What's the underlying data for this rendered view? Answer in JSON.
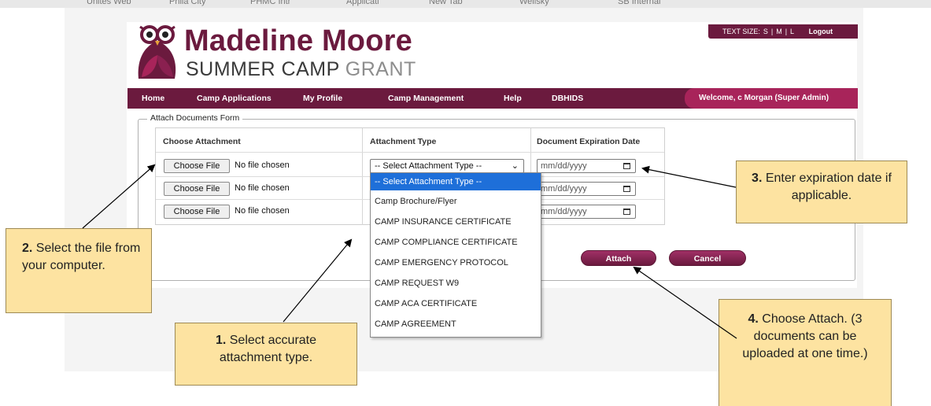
{
  "browser_strip": [
    "Unites Web",
    "Phila City",
    "PHMC Intr",
    "Applicati",
    "New Tab",
    "Wellsky",
    "SB Internal"
  ],
  "header": {
    "brand_line1": "Madeline Moore",
    "brand_line2a": "SUMMER CAMP",
    "brand_line2b": "GRANT",
    "text_size_label": "TEXT SIZE:",
    "size_s": "S",
    "size_m": "M",
    "size_l": "L",
    "separator": "|",
    "logout": "Logout"
  },
  "nav": {
    "items": [
      "Home",
      "Camp Applications",
      "My Profile",
      "Camp Management",
      "Help",
      "DBHIDS"
    ],
    "welcome": "Welcome, c Morgan  (Super Admin)"
  },
  "form": {
    "legend": "Attach Documents Form",
    "col_attachment": "Choose Attachment",
    "col_type": "Attachment Type",
    "col_date": "Document Expiration Date",
    "choose_file": "Choose File",
    "no_file": "No file chosen",
    "select_value": "-- Select Attachment Type --",
    "select_chevron": "⌄",
    "date_placeholder": "mm/dd/yyyy",
    "attach_button": "Attach",
    "cancel_button": "Cancel"
  },
  "dropdown_options": [
    "-- Select Attachment Type --",
    "Camp Brochure/Flyer",
    "CAMP INSURANCE CERTIFICATE",
    "CAMP COMPLIANCE CERTIFICATE",
    "CAMP EMERGENCY PROTOCOL",
    "CAMP REQUEST W9",
    "CAMP ACA CERTIFICATE",
    "CAMP AGREEMENT"
  ],
  "callouts": {
    "c1_num": "1.",
    "c1_text": " Select accurate attachment type.",
    "c2_num": "2.",
    "c2_text": " Select the file from your computer.",
    "c3_num": "3.",
    "c3_text": " Enter expiration date if applicable.",
    "c4_num": "4.",
    "c4_text": " Choose Attach. (3 documents can be uploaded at one time.)"
  },
  "colors": {
    "brand": "#6b1a3e",
    "accent": "#a8245a",
    "callout_bg": "#fde3a1",
    "selected_option": "#1e6fd9"
  },
  "icons": [
    "owl-logo-icon",
    "calendar-icon",
    "chevron-down-icon"
  ]
}
